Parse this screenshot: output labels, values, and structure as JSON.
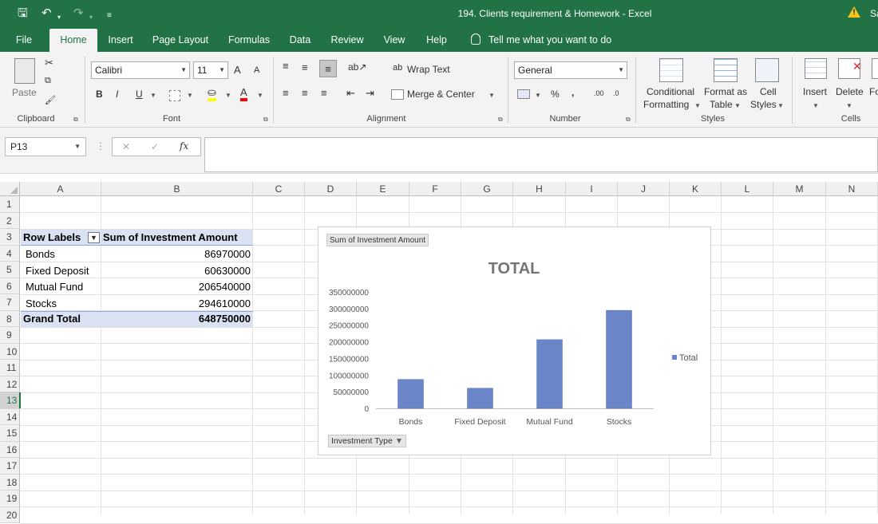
{
  "window": {
    "title": "194. Clients requirement & Homework  -  Excel",
    "user_initial": "Sa"
  },
  "tabs": [
    "File",
    "Home",
    "Insert",
    "Page Layout",
    "Formulas",
    "Data",
    "Review",
    "View",
    "Help"
  ],
  "tell_me": "Tell me what you want to do",
  "ribbon": {
    "clipboard": {
      "paste": "Paste",
      "label": "Clipboard"
    },
    "font": {
      "name": "Calibri",
      "size": "11",
      "grow": "A",
      "shrink": "A",
      "bold": "B",
      "italic": "I",
      "underline": "U",
      "label": "Font"
    },
    "alignment": {
      "wrap_text": "Wrap Text",
      "merge_center": "Merge & Center",
      "label": "Alignment"
    },
    "number": {
      "format": "General",
      "percent": "%",
      "comma": ",",
      "label": "Number",
      "inc": ".00",
      "dec": ".0"
    },
    "styles": {
      "conditional": "Conditional",
      "conditional2": "Formatting",
      "format_as": "Format as",
      "format_as2": "Table",
      "cell": "Cell",
      "cell2": "Styles",
      "label": "Styles"
    },
    "cells": {
      "insert": "Insert",
      "delete": "Delete",
      "format": "Fo",
      "label": "Cells"
    }
  },
  "formula_bar": {
    "name_box": "P13",
    "fx": "fx",
    "cancel": "✕",
    "enter": "✓",
    "content": ""
  },
  "columns": [
    "A",
    "B",
    "C",
    "D",
    "E",
    "F",
    "G",
    "H",
    "I",
    "J",
    "K",
    "L",
    "M",
    "N"
  ],
  "rows": [
    "1",
    "2",
    "3",
    "4",
    "5",
    "6",
    "7",
    "8",
    "9",
    "10",
    "11",
    "12",
    "13",
    "14",
    "15",
    "16",
    "17",
    "18",
    "19",
    "20"
  ],
  "pivot": {
    "header_label": "Row Labels",
    "header_value": "Sum of  Investment Amount",
    "items": [
      {
        "label": "Bonds",
        "value": "86970000"
      },
      {
        "label": "Fixed Deposit",
        "value": "60630000"
      },
      {
        "label": "Mutual Fund",
        "value": "206540000"
      },
      {
        "label": "Stocks",
        "value": "294610000"
      }
    ],
    "total_label": "Grand Total",
    "total_value": "648750000"
  },
  "chart_data": {
    "type": "bar",
    "title": "TOTAL",
    "value_field_button": "Sum of  Investment Amount",
    "axis_field_button": "Investment Type",
    "categories": [
      "Bonds",
      "Fixed Deposit",
      "Mutual Fund",
      "Stocks"
    ],
    "series": [
      {
        "name": "Total",
        "values": [
          86970000,
          60630000,
          206540000,
          294610000
        ]
      }
    ],
    "yticks": [
      "0",
      "50000000",
      "100000000",
      "150000000",
      "200000000",
      "250000000",
      "300000000",
      "350000000"
    ],
    "ylim": [
      0,
      350000000
    ],
    "legend": "right",
    "bar_color": "#6b86c8"
  }
}
